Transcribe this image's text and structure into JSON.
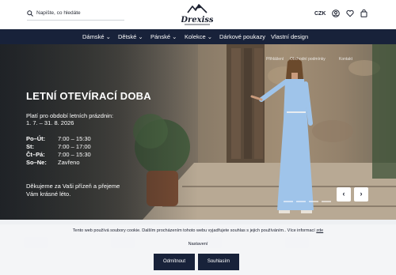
{
  "header": {
    "search_placeholder": "Napište, co hledáte",
    "logo_text": "Drexiss",
    "currency": "CZK",
    "icons": [
      "search-icon",
      "user-icon",
      "heart-icon",
      "cart-icon"
    ]
  },
  "nav": {
    "items": [
      "Dámské ⌄",
      "Dětské ⌄",
      "Pánské ⌄",
      "Kolekce ⌄",
      "Dárkové poukazy",
      "Vlastní design"
    ]
  },
  "hero": {
    "breadcrumb": [
      "Přihlášení",
      "Obchodní podmínky",
      "Kontakt"
    ],
    "title": "LETNÍ OTEVÍRACÍ DOBA",
    "subtitle_line1": "Platí pro období letních prázdnin:",
    "subtitle_line2": "1. 7. – 31. 8. 2026",
    "hours": [
      {
        "day": "Po–Út:",
        "time": "7:00 – 15:30"
      },
      {
        "day": "St:",
        "time": "7:00 – 17:00"
      },
      {
        "day": "Čt–Pá:",
        "time": "7:00 – 15:30"
      },
      {
        "day": "So–Ne:",
        "time": "Zavřeno"
      }
    ],
    "note": "Děkujeme za Vaši přízeň a přejeme Vám krásné léto.",
    "prev_arrow": "‹",
    "next_arrow": "›"
  },
  "cookie": {
    "text": "Tento web používá soubory cookie. Dalším procházením tohoto webu vyjadřujete souhlas s jejich používáním.. Více informací ",
    "link": "zde",
    "settings": "Nastavení",
    "reject": "Odmítnout",
    "accept": "Souhlasím"
  },
  "colors": {
    "nav_bg": "#18223a",
    "button_bg": "#18223a",
    "dress": "#9fc4ea"
  }
}
